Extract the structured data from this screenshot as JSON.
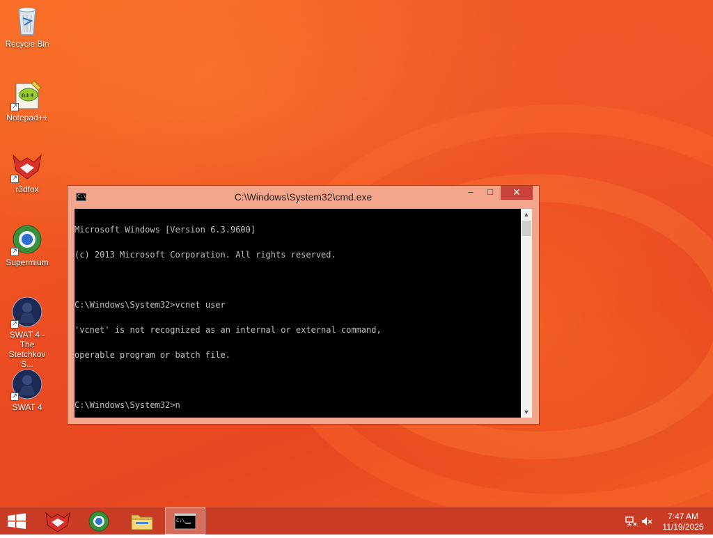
{
  "desktop_icons": [
    {
      "label": "Recycle Bin",
      "icon": "recycle-bin-icon"
    },
    {
      "label": "Notepad++",
      "icon": "notepad-plus-plus-icon"
    },
    {
      "label": "r3dfox",
      "icon": "r3dfox-icon"
    },
    {
      "label": "Supermium",
      "icon": "supermium-icon"
    },
    {
      "label": "SWAT 4 - The Stetchkov S...",
      "icon": "swat4-icon"
    },
    {
      "label": "SWAT 4",
      "icon": "swat4-icon"
    }
  ],
  "cmd_window": {
    "title": "C:\\Windows\\System32\\cmd.exe",
    "minimize_glyph": "–",
    "maximize_glyph": "□",
    "close_glyph": "✕",
    "console_lines": [
      "Microsoft Windows [Version 6.3.9600]",
      "(c) 2013 Microsoft Corporation. All rights reserved.",
      "",
      "C:\\Windows\\System32>vcnet user",
      "'vcnet' is not recognized as an internal or external command,",
      "operable program or batch file.",
      "",
      "C:\\Windows\\System32>n"
    ],
    "scroll_up_glyph": "▲",
    "scroll_down_glyph": "▼"
  },
  "taskbar": {
    "items": [
      {
        "name": "start",
        "icon": "windows-logo-icon"
      },
      {
        "name": "r3dfox",
        "icon": "r3dfox-icon"
      },
      {
        "name": "supermium",
        "icon": "supermium-icon"
      },
      {
        "name": "file-explorer",
        "icon": "folder-icon"
      },
      {
        "name": "cmd",
        "icon": "cmd-icon",
        "active": true
      }
    ],
    "time": "7:47 AM",
    "date": "11/19/2025"
  },
  "colors": {
    "taskbar": "#c83c25",
    "window_frame": "#f2a58b",
    "close_button": "#c9423a",
    "console_bg": "#000000",
    "console_text": "#c0c0c0"
  }
}
